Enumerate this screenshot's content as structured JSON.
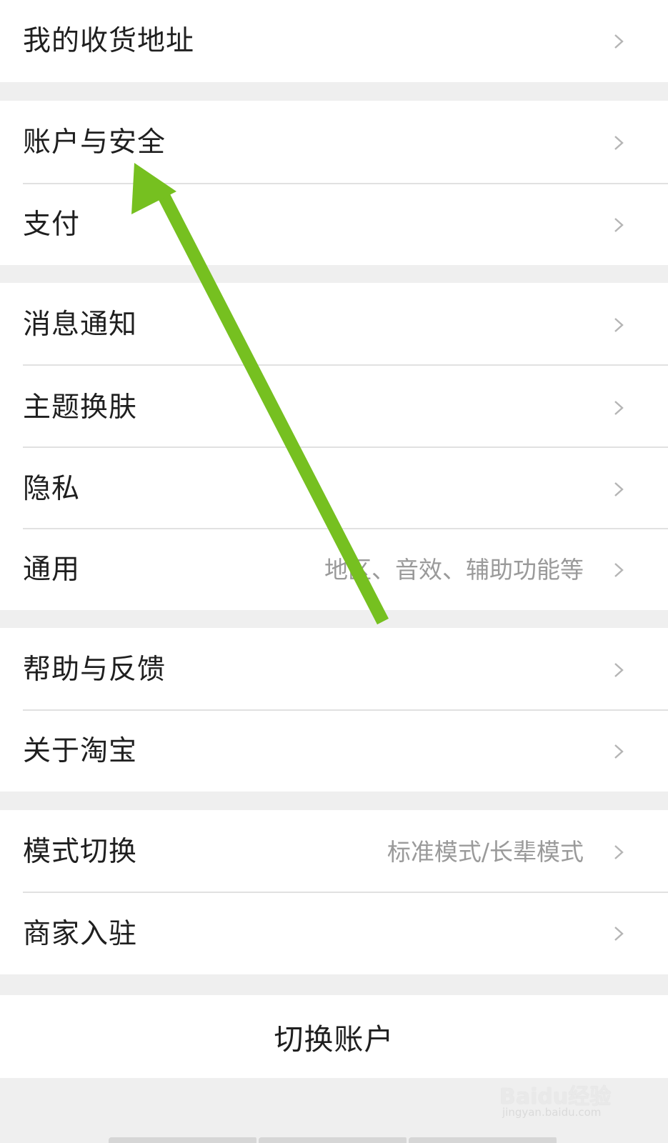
{
  "settings": {
    "groups": [
      {
        "items": [
          {
            "label": "我的收货地址",
            "hint": ""
          }
        ]
      },
      {
        "items": [
          {
            "label": "账户与安全",
            "hint": ""
          },
          {
            "label": "支付",
            "hint": ""
          }
        ]
      },
      {
        "items": [
          {
            "label": "消息通知",
            "hint": ""
          },
          {
            "label": "主题换肤",
            "hint": ""
          },
          {
            "label": "隐私",
            "hint": ""
          },
          {
            "label": "通用",
            "hint": "地区、音效、辅助功能等"
          }
        ]
      },
      {
        "items": [
          {
            "label": "帮助与反馈",
            "hint": ""
          },
          {
            "label": "关于淘宝",
            "hint": ""
          }
        ]
      },
      {
        "items": [
          {
            "label": "模式切换",
            "hint": "标准模式/长辈模式"
          },
          {
            "label": "商家入驻",
            "hint": ""
          }
        ]
      }
    ],
    "switch_account_label": "切换账户"
  },
  "annotation": {
    "arrow_color": "#76c020",
    "icon": "arrow-up-left-icon"
  },
  "watermark": {
    "main": "Baidu经验",
    "sub": "jingyan.baidu.com"
  },
  "icons": {
    "chevron": "chevron-right-icon"
  }
}
